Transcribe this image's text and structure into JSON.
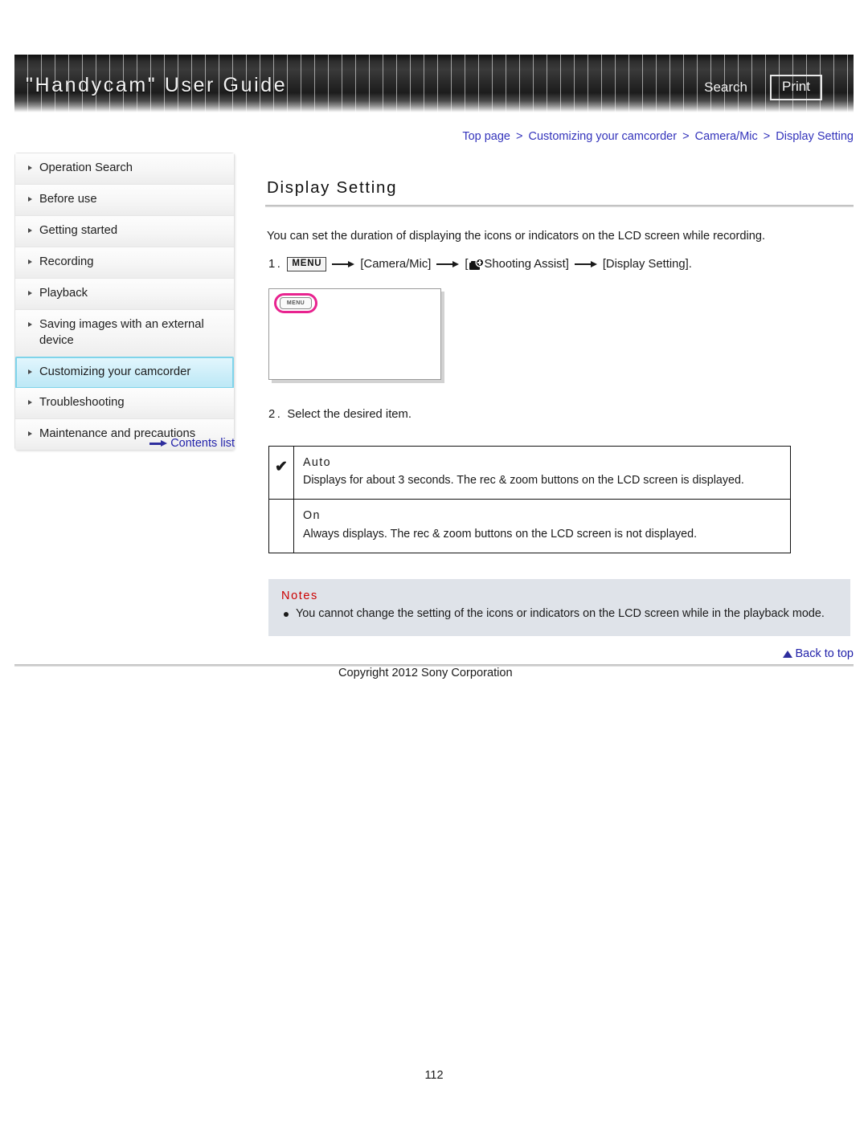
{
  "header": {
    "site_title": "\"Handycam\" User Guide",
    "search_label": "Search",
    "print_label": "Print"
  },
  "breadcrumb": {
    "items": [
      "Top page",
      "Customizing your camcorder",
      "Camera/Mic",
      "Display Setting"
    ],
    "separator": ">"
  },
  "sidebar": {
    "items": [
      {
        "label": "Operation Search",
        "active": false
      },
      {
        "label": "Before use",
        "active": false
      },
      {
        "label": "Getting started",
        "active": false
      },
      {
        "label": "Recording",
        "active": false
      },
      {
        "label": "Playback",
        "active": false
      },
      {
        "label": "Saving images with an external device",
        "active": false
      },
      {
        "label": "Customizing your camcorder",
        "active": true
      },
      {
        "label": "Troubleshooting",
        "active": false
      },
      {
        "label": "Maintenance and precautions",
        "active": false
      }
    ],
    "contents_list_label": "Contents list"
  },
  "main": {
    "page_title": "Display Setting",
    "intro": "You can set the duration of displaying the icons or indicators on the LCD screen while recording.",
    "step1": {
      "number": "1.",
      "menu_chip": "MENU",
      "part_camera_mic": "[Camera/Mic]",
      "part_open_bracket": "[",
      "part_shooting_assist": "Shooting Assist]",
      "part_display_setting": "[Display Setting]."
    },
    "figure": {
      "menu_chip": "MENU"
    },
    "step2": {
      "number": "2.",
      "text": "Select the desired item."
    },
    "options_table": {
      "rows": [
        {
          "checked": "✔",
          "name": "Auto",
          "description": "Displays for about 3 seconds. The rec & zoom buttons on the LCD screen is displayed."
        },
        {
          "checked": "",
          "name": "On",
          "description": "Always displays. The rec & zoom buttons on the LCD screen is not displayed."
        }
      ]
    },
    "notes": {
      "title": "Notes",
      "items": [
        "You cannot change the setting of the icons or indicators on the LCD screen while in the playback mode."
      ]
    },
    "back_to_top_label": "Back to top"
  },
  "footer": {
    "copyright": "Copyright 2012 Sony Corporation",
    "page_number": "112"
  },
  "colors": {
    "link_blue": "#2222aa",
    "breadcrumb_blue": "#3333bb",
    "notes_red": "#cc0000",
    "highlight_cyan": "#bde8f6",
    "figure_highlight_magenta": "#e8238f"
  }
}
